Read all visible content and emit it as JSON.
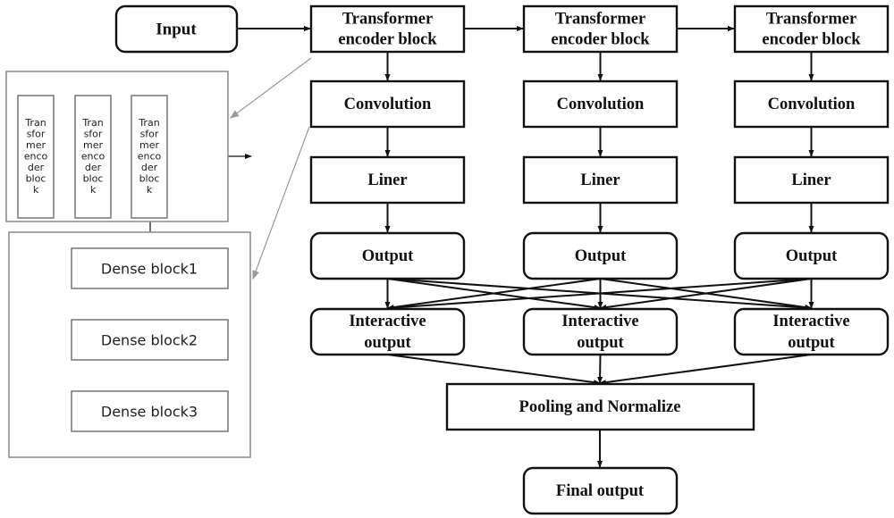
{
  "main": {
    "input": "Input",
    "columns": [
      {
        "encoder": [
          "Transformer",
          "encoder block"
        ],
        "convolution": "Convolution",
        "liner": "Liner",
        "output": "Output",
        "interactive": [
          "Interactive",
          "output"
        ]
      },
      {
        "encoder": [
          "Transformer",
          "encoder block"
        ],
        "convolution": "Convolution",
        "liner": "Liner",
        "output": "Output",
        "interactive": [
          "Interactive",
          "output"
        ]
      },
      {
        "encoder": [
          "Transformer",
          "encoder block"
        ],
        "convolution": "Convolution",
        "liner": "Liner",
        "output": "Output",
        "interactive": [
          "Interactive",
          "output"
        ]
      }
    ],
    "pooling": "Pooling and Normalize",
    "final": "Final output"
  },
  "inset_encoders": {
    "blocks": [
      [
        "Tran",
        "sfor",
        "mer",
        "enco",
        "der",
        "bloc",
        "k"
      ],
      [
        "Tran",
        "sfor",
        "mer",
        "enco",
        "der",
        "bloc",
        "k"
      ],
      [
        "Tran",
        "sfor",
        "mer",
        "enco",
        "der",
        "bloc",
        "k"
      ]
    ]
  },
  "inset_dense": {
    "blocks": [
      "Dense block1",
      "Dense block2",
      "Dense block3"
    ]
  }
}
